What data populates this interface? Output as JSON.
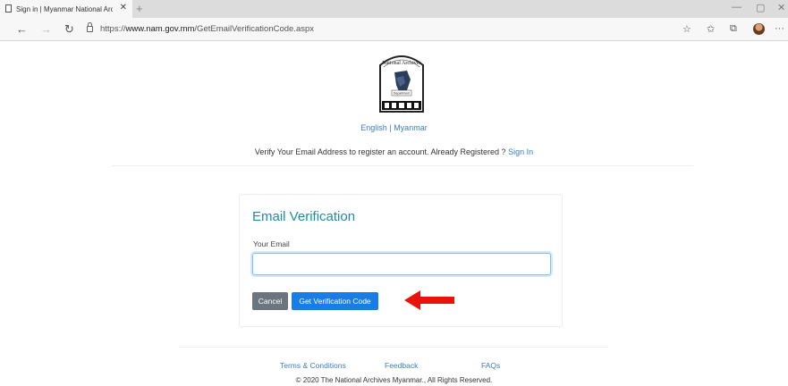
{
  "browser": {
    "tab_title": "Sign in | Myanmar National Arc",
    "tab_close": "✕",
    "new_tab": "+",
    "url_scheme": "https://",
    "url_host": "www.nam.gov.mm",
    "url_path": "/GetEmailVerificationCode.aspx",
    "icons": [
      "page-icon",
      "close-icon",
      "plus-icon",
      "minimize-icon",
      "maximize-icon",
      "close-window-icon",
      "back-icon",
      "forward-icon",
      "refresh-icon",
      "lock-icon",
      "star-icon",
      "favorites-icon",
      "collections-icon",
      "profile-avatar-icon",
      "more-icon"
    ]
  },
  "header": {
    "logo_text": "National Archives Department",
    "lang_english": "English",
    "lang_sep": "|",
    "lang_myanmar": "Myanmar",
    "verify_text": "Verify Your Email Address to register an account. Already Registered ? ",
    "signin_link": "Sign In"
  },
  "form": {
    "title": "Email Verification",
    "email_label": "Your Email",
    "email_value": "",
    "cancel_label": "Cancel",
    "submit_label": "Get Verification Code"
  },
  "footer": {
    "terms": "Terms & Conditions",
    "feedback": "Feedback",
    "faqs": "FAQs",
    "copyright": "© 2020 The National Archives Myanmar., All Rights Reserved."
  },
  "colors": {
    "link": "#3a7cc9",
    "title": "#1d8ea0",
    "primary_button": "#1a7de6",
    "cancel_button": "#6c757d",
    "arrow": "#e8140c"
  }
}
